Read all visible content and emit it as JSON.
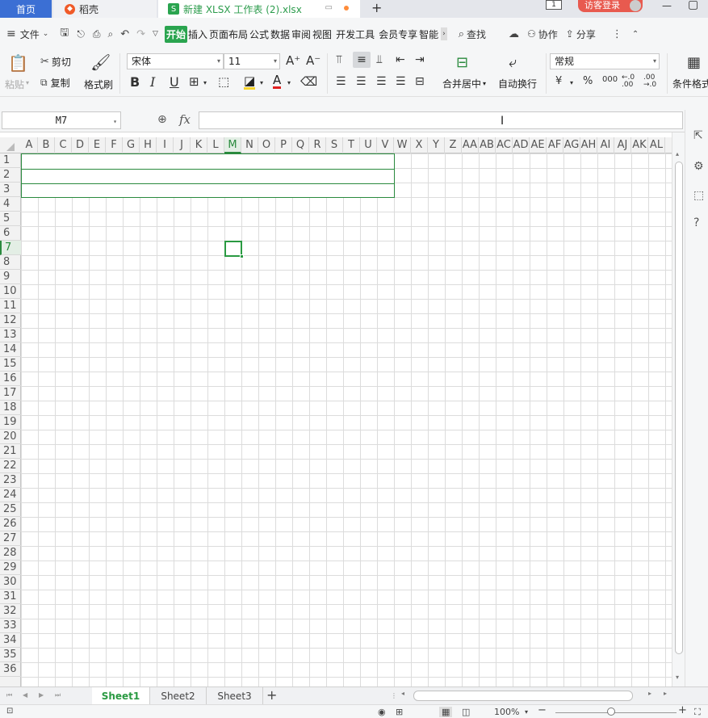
{
  "titlebar": {
    "tabs": [
      {
        "label": "首页"
      },
      {
        "label": "稻壳"
      },
      {
        "label": "新建 XLSX 工作表 (2).xlsx"
      }
    ],
    "new_tab": "+",
    "win_badge": "1",
    "login_label": "访客登录"
  },
  "menubar": {
    "file_label": "文件",
    "ribbon_tabs": [
      "开始",
      "插入",
      "页面布局",
      "公式",
      "数据",
      "审阅",
      "视图",
      "开发工具",
      "会员专享",
      "智能"
    ],
    "search_label": "查找",
    "collab_label": "协作",
    "share_label": "分享"
  },
  "ribbon": {
    "paste_label": "粘贴",
    "cut_label": "剪切",
    "copy_label": "复制",
    "format_painter_label": "格式刷",
    "font_name": "宋体",
    "font_size": "11",
    "merge_label": "合并居中",
    "wrap_label": "自动换行",
    "number_format": "常规",
    "cond_format_label": "条件格式",
    "currency_symbol": "¥",
    "percent_symbol": "%",
    "thousands_symbol": "000"
  },
  "formula": {
    "cell_ref": "M7",
    "fx_label": "fx",
    "content": ""
  },
  "sheet": {
    "columns": [
      "A",
      "B",
      "C",
      "D",
      "E",
      "F",
      "G",
      "H",
      "I",
      "J",
      "K",
      "L",
      "M",
      "N",
      "O",
      "P",
      "Q",
      "R",
      "S",
      "T",
      "U",
      "V",
      "W",
      "X",
      "Y",
      "Z",
      "AA",
      "AB",
      "AC",
      "AD",
      "AE",
      "AF",
      "AG",
      "AH",
      "AI",
      "AJ",
      "AK",
      "AL"
    ],
    "selected_column": "M",
    "rows": [
      "1",
      "2",
      "3",
      "4",
      "5",
      "6",
      "7",
      "8",
      "9",
      "10",
      "11",
      "12",
      "13",
      "14",
      "15",
      "16",
      "17",
      "18",
      "19",
      "20",
      "21",
      "22",
      "23",
      "24",
      "25",
      "26",
      "27",
      "28",
      "29",
      "30",
      "31",
      "32",
      "33",
      "34",
      "35",
      "36"
    ],
    "selected_row": "7"
  },
  "sheettabs": {
    "tabs": [
      "Sheet1",
      "Sheet2",
      "Sheet3"
    ],
    "active": "Sheet1",
    "add_label": "+"
  },
  "statusbar": {
    "zoom": "100%",
    "minus": "−",
    "plus": "+"
  },
  "colors": {
    "accent": "#2aa44f",
    "home_tab": "#3b6fd4",
    "login": "#e85a4f"
  }
}
